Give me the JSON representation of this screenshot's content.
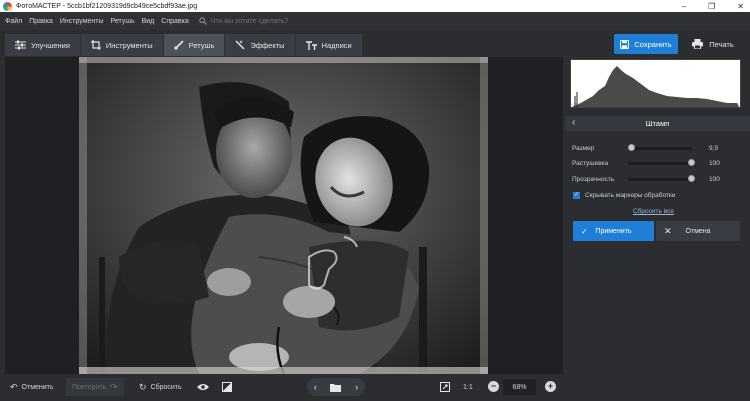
{
  "window": {
    "title": "ФотоМАСТЕР - 5ccb1bf21209319d9cb49ce5cbdf93ae.jpg",
    "controls": [
      "–",
      "❐",
      "✕"
    ]
  },
  "menu": {
    "items": [
      "Файл",
      "Правка",
      "Инструменты",
      "Ретушь",
      "Вид",
      "Справка"
    ],
    "search_placeholder": "Что вы хотите сделать?"
  },
  "toolbar": {
    "tabs": [
      {
        "label": "Улучшения",
        "icon": "sliders-icon"
      },
      {
        "label": "Инструменты",
        "icon": "crop-icon"
      },
      {
        "label": "Ретушь",
        "icon": "brush-icon",
        "active": true
      },
      {
        "label": "Эффекты",
        "icon": "magic-wand-icon"
      },
      {
        "label": "Надписи",
        "icon": "text-icon"
      }
    ],
    "save_label": "Сохранить",
    "print_label": "Печать"
  },
  "panel": {
    "title": "Штамп",
    "sliders": [
      {
        "label": "Размер",
        "value": "9,9",
        "fraction": 0.07
      },
      {
        "label": "Растушевка",
        "value": "100",
        "fraction": 1.0
      },
      {
        "label": "Прозрачность",
        "value": "100",
        "fraction": 1.0
      }
    ],
    "hide_markers_label": "Скрывать маркеры обработки",
    "hide_markers_checked": true,
    "reset_all_label": "Сбросить все",
    "apply_label": "Применить",
    "cancel_label": "Отмена"
  },
  "bottom": {
    "undo_label": "Отменить",
    "redo_label": "Повторить",
    "reset_label": "Сбросить",
    "ratio_label": "1:1",
    "zoom_value": "68%"
  },
  "colors": {
    "accent": "#1f7fd6",
    "background": "#2b2d31",
    "canvas": "#1e2024"
  }
}
